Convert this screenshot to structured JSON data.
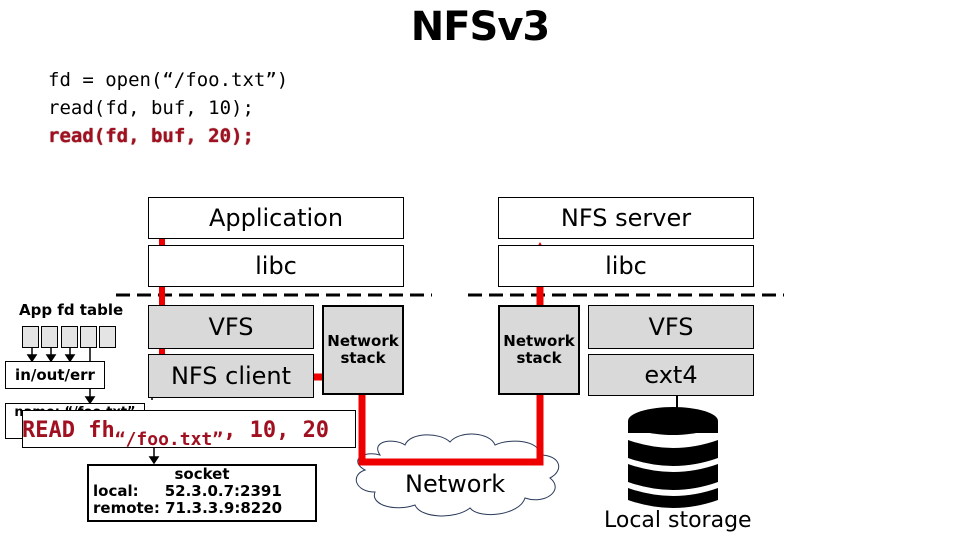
{
  "title": "NFSv3",
  "code": {
    "lines": [
      "fd = open(“/foo.txt”)",
      "read(fd, buf, 10);",
      "read(fd, buf, 20);"
    ],
    "highlighted_line_index": 2
  },
  "client": {
    "application": "Application",
    "libc": "libc",
    "vfs": "VFS",
    "nfs_client": "NFS client",
    "network_stack": "Network stack"
  },
  "server": {
    "nfs_server": "NFS server",
    "libc": "libc",
    "vfs": "VFS",
    "ext4": "ext4",
    "network_stack": "Network stack",
    "local_storage": "Local storage"
  },
  "fd_table": {
    "label": "App fd table",
    "cell_count": 5,
    "stdio_label": "in/out/err",
    "file_entry": "name: “/foo.txt”"
  },
  "request": {
    "prefix": "READ fh",
    "handle": "“/foo.txt”",
    "suffix": ", 10, 20"
  },
  "socket": {
    "label": "socket",
    "local_label": "local:",
    "local_value": "52.3.0.7:2391",
    "remote_label": "remote:",
    "remote_value": "71.3.3.9:8220"
  },
  "network": {
    "label": "Network"
  },
  "colors": {
    "arrow": "#ee0000",
    "highlight_text": "#a01020",
    "gray_box": "#d9d9d9",
    "cloud_stroke": "#2a3a5a"
  }
}
